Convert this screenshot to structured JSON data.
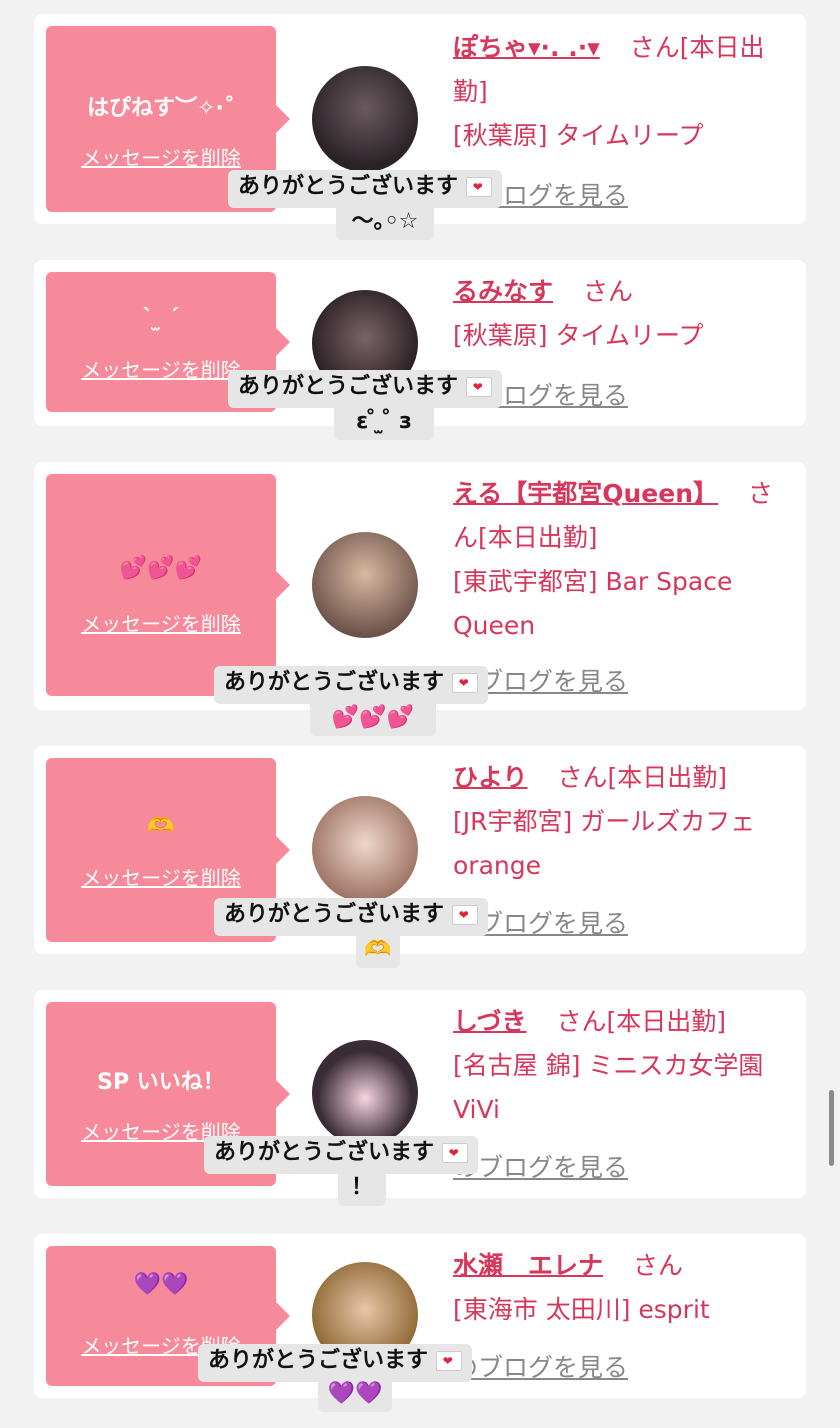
{
  "cards": [
    {
      "message": "はぴねす︶✧·˚",
      "delete_label": "メッセージを削除",
      "name": "ぽちゃ▾·. .·▾",
      "san": "さん",
      "status_line": "[本日出勤]",
      "shop": "[秋葉原] タイムリープ",
      "blog": "のブログを見る",
      "tooltip": "ありがとうございます",
      "tooltip_extra": "〜｡◦☆"
    },
    {
      "message": "ˋ ̫ ˊ",
      "delete_label": "メッセージを削除",
      "name": "るみなす",
      "san": "さん",
      "status_line": "",
      "shop": "[秋葉原] タイムリープ",
      "blog": "のブログを見る",
      "tooltip": "ありがとうございます",
      "tooltip_extra": "ε ̊ ̫ ̊ з"
    },
    {
      "message": "💕💕💕",
      "delete_label": "メッセージを削除",
      "name": "える【宇都宮Queen】",
      "san": "さん",
      "status_line": "[本日出勤]",
      "shop": "[東武宇都宮] Bar Space Queen",
      "blog": "のブログを見る",
      "tooltip": "ありがとうございます",
      "tooltip_extra": "💕💕💕"
    },
    {
      "message": "🫶",
      "delete_label": "メッセージを削除",
      "name": "ひより",
      "san": "さん",
      "status_line": "[本日出勤]",
      "shop": "[JR宇都宮] ガールズカフェorange",
      "blog": "のブログを見る",
      "tooltip": "ありがとうございます",
      "tooltip_extra": "🫶"
    },
    {
      "message": "SP いいね！",
      "delete_label": "メッセージを削除",
      "name": "しづき",
      "san": "さん",
      "status_line": "[本日出勤]",
      "shop": "[名古屋 錦] ミニスカ女学園ViVi",
      "blog": "のブログを見る",
      "tooltip": "ありがとうございます",
      "tooltip_extra": "！"
    },
    {
      "message": "💜💜",
      "delete_label": "メッセージを削除",
      "name": "水瀬　エレナ",
      "san": "さん",
      "status_line": "",
      "shop": "[東海市 太田川] esprit",
      "blog": "のブログを見る",
      "tooltip": "ありがとうございます",
      "tooltip_extra": "💜💜"
    }
  ],
  "colors": {
    "accent": "#d6375a",
    "bubble": "#f78a9a",
    "background": "#f2f2f2"
  }
}
